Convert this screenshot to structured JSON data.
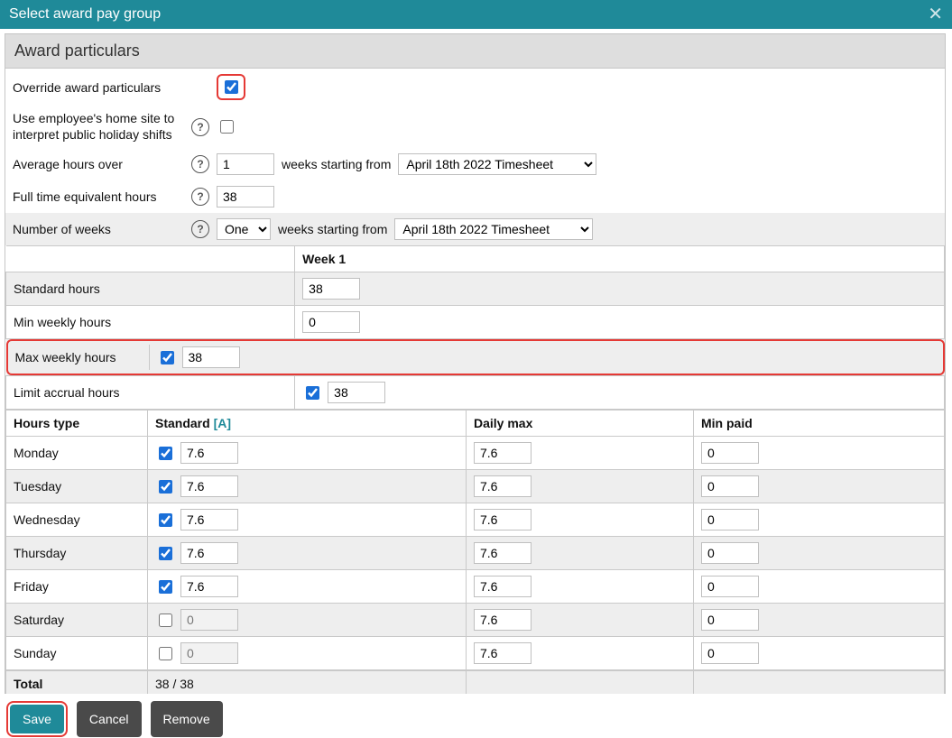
{
  "title": "Select award pay group",
  "section_header": "Award particulars",
  "labels": {
    "override": "Override award particulars",
    "use_home_site": "Use employee's home site to interpret public holiday shifts",
    "avg_hours_over": "Average hours over",
    "weeks_starting_from": "weeks starting from",
    "fte_hours": "Full time equivalent hours",
    "num_weeks": "Number of weeks",
    "standard_hours": "Standard hours",
    "min_weekly": "Min weekly hours",
    "max_weekly": "Max weekly hours",
    "limit_accrual": "Limit accrual hours",
    "hours_type": "Hours type",
    "standard": "Standard",
    "standard_a": "[A]",
    "daily_max": "Daily max",
    "min_paid": "Min paid",
    "total": "Total",
    "week1": "Week 1"
  },
  "values": {
    "override_checked": true,
    "use_home_site_checked": false,
    "avg_hours_over": "1",
    "timesheet_selected": "April 18th 2022 Timesheet",
    "fte_hours": "38",
    "num_weeks_selected": "One",
    "num_weeks_options": [
      "One"
    ],
    "standard_hours": "38",
    "min_weekly": "0",
    "max_weekly_checked": true,
    "max_weekly": "38",
    "limit_accrual_checked": true,
    "limit_accrual": "38",
    "total_display": "38 / 38"
  },
  "days": [
    {
      "name": "Monday",
      "checked": true,
      "std": "7.6",
      "dmax": "7.6",
      "mpaid": "0",
      "shade": false
    },
    {
      "name": "Tuesday",
      "checked": true,
      "std": "7.6",
      "dmax": "7.6",
      "mpaid": "0",
      "shade": true
    },
    {
      "name": "Wednesday",
      "checked": true,
      "std": "7.6",
      "dmax": "7.6",
      "mpaid": "0",
      "shade": false
    },
    {
      "name": "Thursday",
      "checked": true,
      "std": "7.6",
      "dmax": "7.6",
      "mpaid": "0",
      "shade": true
    },
    {
      "name": "Friday",
      "checked": true,
      "std": "7.6",
      "dmax": "7.6",
      "mpaid": "0",
      "shade": false
    },
    {
      "name": "Saturday",
      "checked": false,
      "std": "0",
      "dmax": "7.6",
      "mpaid": "0",
      "shade": true
    },
    {
      "name": "Sunday",
      "checked": false,
      "std": "0",
      "dmax": "7.6",
      "mpaid": "0",
      "shade": false
    }
  ],
  "buttons": {
    "save": "Save",
    "cancel": "Cancel",
    "remove": "Remove"
  }
}
